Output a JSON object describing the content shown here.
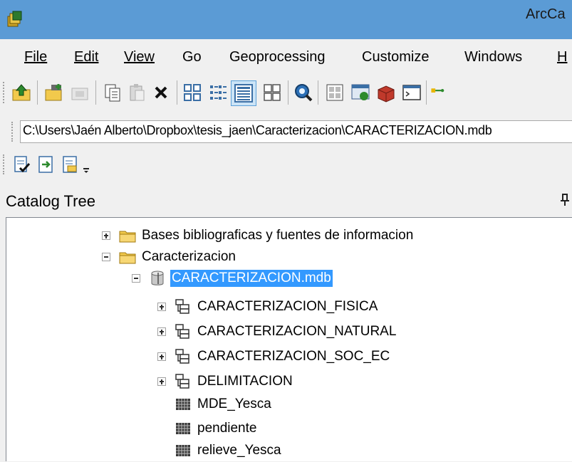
{
  "window": {
    "title": "ArcCa"
  },
  "menu": [
    {
      "label": "File"
    },
    {
      "label": "Edit"
    },
    {
      "label": "View"
    },
    {
      "label": "Go"
    },
    {
      "label": "Geoprocessing"
    },
    {
      "label": "Customize"
    },
    {
      "label": "Windows"
    },
    {
      "label": "H"
    }
  ],
  "location": {
    "path": "C:\\Users\\Jaén Alberto\\Dropbox\\tesis_jaen\\Caracterizacion\\CARACTERIZACION.mdb"
  },
  "catalog": {
    "title": "Catalog Tree",
    "items": [
      {
        "label": "Bases bibliograficas y fuentes de informacion",
        "icon": "folder-icon",
        "expander": "plus"
      },
      {
        "label": "Caracterizacion",
        "icon": "folder-icon",
        "expander": "minus"
      },
      {
        "label": "CARACTERIZACION.mdb",
        "icon": "geodatabase-icon",
        "expander": "minus",
        "selected": true
      },
      {
        "label": "CARACTERIZACION_FISICA",
        "icon": "feature-dataset-icon",
        "expander": "plus"
      },
      {
        "label": "CARACTERIZACION_NATURAL",
        "icon": "feature-dataset-icon",
        "expander": "plus"
      },
      {
        "label": "CARACTERIZACION_SOC_EC",
        "icon": "feature-dataset-icon",
        "expander": "plus"
      },
      {
        "label": "DELIMITACION",
        "icon": "feature-dataset-icon",
        "expander": "plus"
      },
      {
        "label": "MDE_Yesca",
        "icon": "raster-icon"
      },
      {
        "label": "pendiente",
        "icon": "raster-icon"
      },
      {
        "label": "relieve_Yesca",
        "icon": "raster-icon"
      }
    ]
  },
  "colors": {
    "titlebar": "#5b9bd5",
    "selection": "#3399ff"
  }
}
